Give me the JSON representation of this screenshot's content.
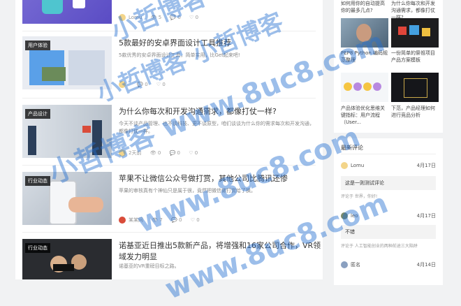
{
  "top_post": {
    "author": "Lomu",
    "views": "5",
    "comments": "0",
    "likes": "0"
  },
  "posts": [
    {
      "category": "用户体验",
      "title": "5款最好的安卓界面设计工具推荐",
      "excerpt": "5款优秀的安卓界面设计工具，简单实用，比Get起来吧!",
      "meta": [
        "0",
        "0"
      ]
    },
    {
      "category": "产品设计",
      "title": "为什么你每次和开发沟通需求，都像打仗一样?",
      "excerpt": "今天不谈产品管理、也不谈科技、更不谈原型，咱们谈谈为什么你的需求每次和开发沟通，都像打仗一样。",
      "meta": [
        "2天前",
        "0",
        "0",
        "0"
      ]
    },
    {
      "category": "行业动态",
      "title": "苹果不让微信公众号做打赏，其他公司比腾讯还惨",
      "excerpt": "苹果的审核真有个神仙只是属于很，竟然把微信做打赏给了换。",
      "meta": [
        "某某网",
        "7",
        "0",
        "0"
      ]
    },
    {
      "category": "行业动态",
      "title": "诺基亚近日推出5款新产品，将增强和16家公司合作，VR领域发力明显",
      "excerpt": "诺基亚的VR重磅目标之路。"
    }
  ],
  "sidebar": {
    "cards": [
      {
        "caption": "PEP8 Python 编码规范整理"
      },
      {
        "caption": "一份简单的祭祖项目产品方案模板"
      },
      {
        "caption": "产品体验优化思维关键指标：用户流程（User..."
      },
      {
        "caption": "下范，产品经理如何进行竞品分析"
      }
    ],
    "top_captions": [
      "如何用你的自动提高你的最多几点?",
      "为什么你每次和开发沟通需求，都像打仗一样?"
    ],
    "comments_title": "最新评论",
    "comments": [
      {
        "author": "Lomu",
        "date": "4月17日",
        "text": "这是一则测试评论",
        "sub": "评论于 世界，你好!"
      },
      {
        "author": "leo",
        "date": "4月17日",
        "text": "不错",
        "sub": "评论于 人工智能创业的两种前途三大陷阱"
      },
      {
        "author": "匿名",
        "date": "4月14日"
      }
    ]
  },
  "watermark": {
    "lines": [
      "小哲博客 小哲博客 小哲博客",
      "小哲博客 小哲博客",
      "小哲博客 www.8uc8.com",
      "www.8uc8.com",
      "www.8uc8.com"
    ]
  },
  "colors": {
    "watermark": "#246fd1",
    "accent": "#3b6fd4"
  }
}
